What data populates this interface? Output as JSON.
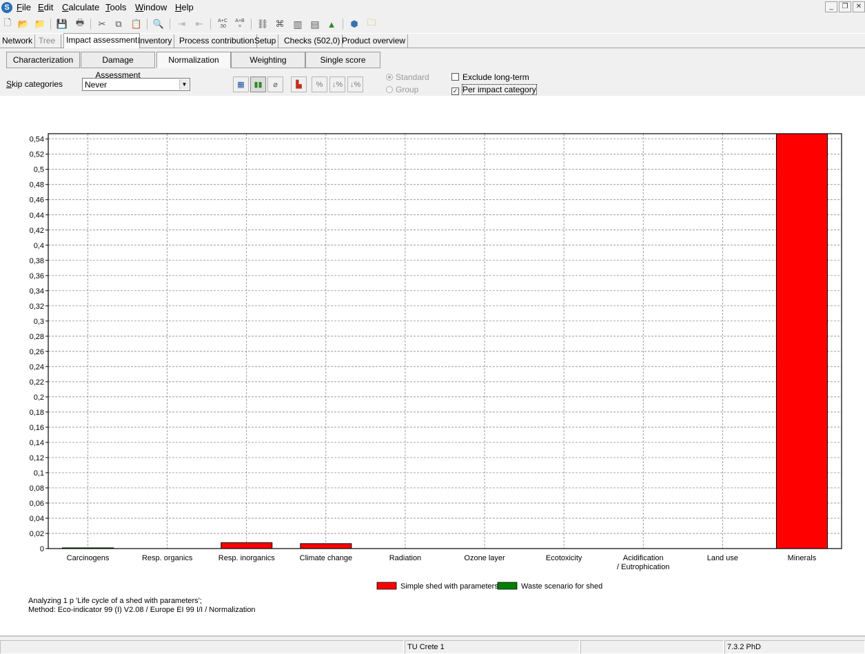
{
  "menu": [
    "File",
    "Edit",
    "Calculate",
    "Tools",
    "Window",
    "Help"
  ],
  "toolbar": {
    "tiny1_top": "A+C",
    "tiny1_bottom": ".50",
    "tiny2_top": "A+B",
    "tiny2_bottom": "="
  },
  "tabs": [
    "Network",
    "Tree",
    "Impact assessment",
    "Inventory",
    "Process contribution",
    "Setup",
    "Checks (502,0)",
    "Product overview"
  ],
  "subtabs": [
    "Characterization",
    "Damage Assessment",
    "Normalization",
    "Weighting",
    "Single score"
  ],
  "skip_categories": {
    "label": "Skip categories",
    "value": "Never"
  },
  "options": {
    "standard": "Standard",
    "group": "Group",
    "exclude_long_term": "Exclude long-term",
    "per_impact_category": "Per impact category"
  },
  "chart_data": {
    "type": "bar",
    "categories": [
      "Carcinogens",
      "Resp. organics",
      "Resp. inorganics",
      "Climate change",
      "Radiation",
      "Ozone layer",
      "Ecotoxicity",
      "Acidification / Eutrophication",
      "Land use",
      "Minerals"
    ],
    "series": [
      {
        "name": "Simple shed with parameters",
        "color": "#ff0000",
        "values": [
          0.0001,
          0.0,
          0.0077,
          0.0065,
          0.0,
          0.0,
          0.0,
          0.0,
          0.0,
          0.547
        ]
      },
      {
        "name": "Waste scenario for shed",
        "color": "#008000",
        "values": [
          0.0004,
          0.0,
          0.0,
          0.0,
          0.0,
          0.0,
          0.0,
          0.0,
          0.0,
          0.0
        ]
      }
    ],
    "ylim": [
      0,
      0.547
    ],
    "yticks": [
      "0",
      "0,02",
      "0,04",
      "0,06",
      "0,08",
      "0,1",
      "0,12",
      "0,14",
      "0,16",
      "0,18",
      "0,2",
      "0,22",
      "0,24",
      "0,26",
      "0,28",
      "0,3",
      "0,32",
      "0,34",
      "0,36",
      "0,38",
      "0,4",
      "0,42",
      "0,44",
      "0,46",
      "0,48",
      "0,5",
      "0,52",
      "0,54"
    ],
    "grid": true,
    "legend": "bottom-center"
  },
  "info": {
    "line1": "Analyzing 1 p 'Life cycle of a shed with parameters';",
    "line2": "Method: Eco-indicator 99 (I) V2.08 / Europe EI 99 I/I / Normalization"
  },
  "status": {
    "user": "TU Crete 1",
    "version": "7.3.2 PhD"
  }
}
